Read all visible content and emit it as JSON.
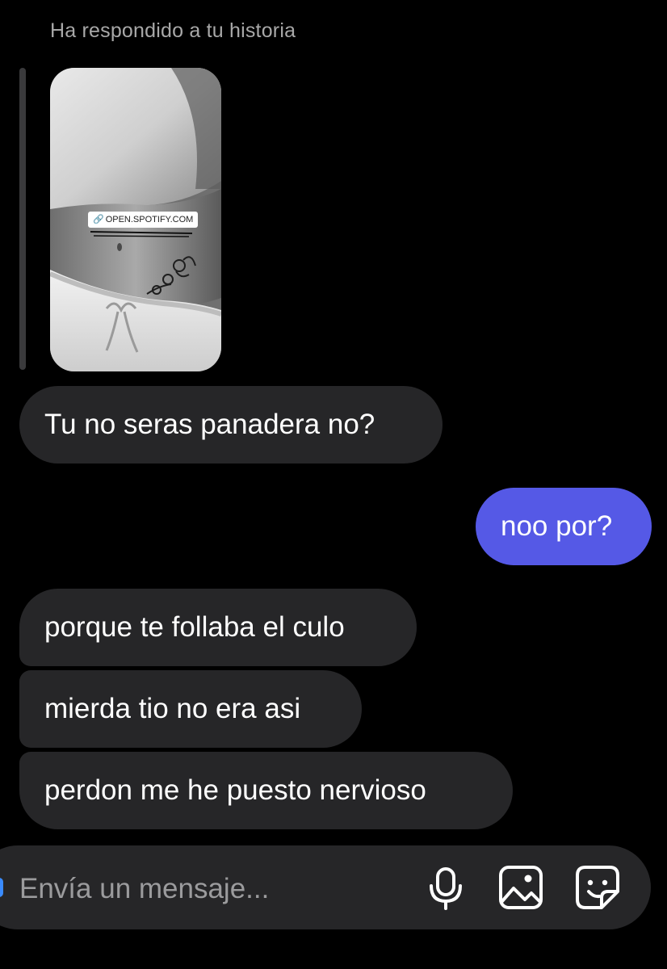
{
  "reply": {
    "header": "Ha respondido a tu historia",
    "story_link_sticker": "OPEN.SPOTIFY.COM"
  },
  "messages": [
    {
      "direction": "incoming",
      "text": "Tu no seras panadera no?"
    },
    {
      "direction": "outgoing",
      "text": "noo por?"
    },
    {
      "direction": "incoming",
      "text": "porque te follaba el culo"
    },
    {
      "direction": "incoming",
      "text": "mierda tio no era asi"
    },
    {
      "direction": "incoming",
      "text": "perdon me he puesto nervioso"
    }
  ],
  "composer": {
    "placeholder": "Envía un mensaje...",
    "icons": [
      "microphone-icon",
      "gallery-icon",
      "sticker-icon"
    ]
  },
  "colors": {
    "background": "#000000",
    "incoming_bubble": "#262628",
    "outgoing_bubble": "#5559e6",
    "secondary_text": "#a8a8a8"
  }
}
